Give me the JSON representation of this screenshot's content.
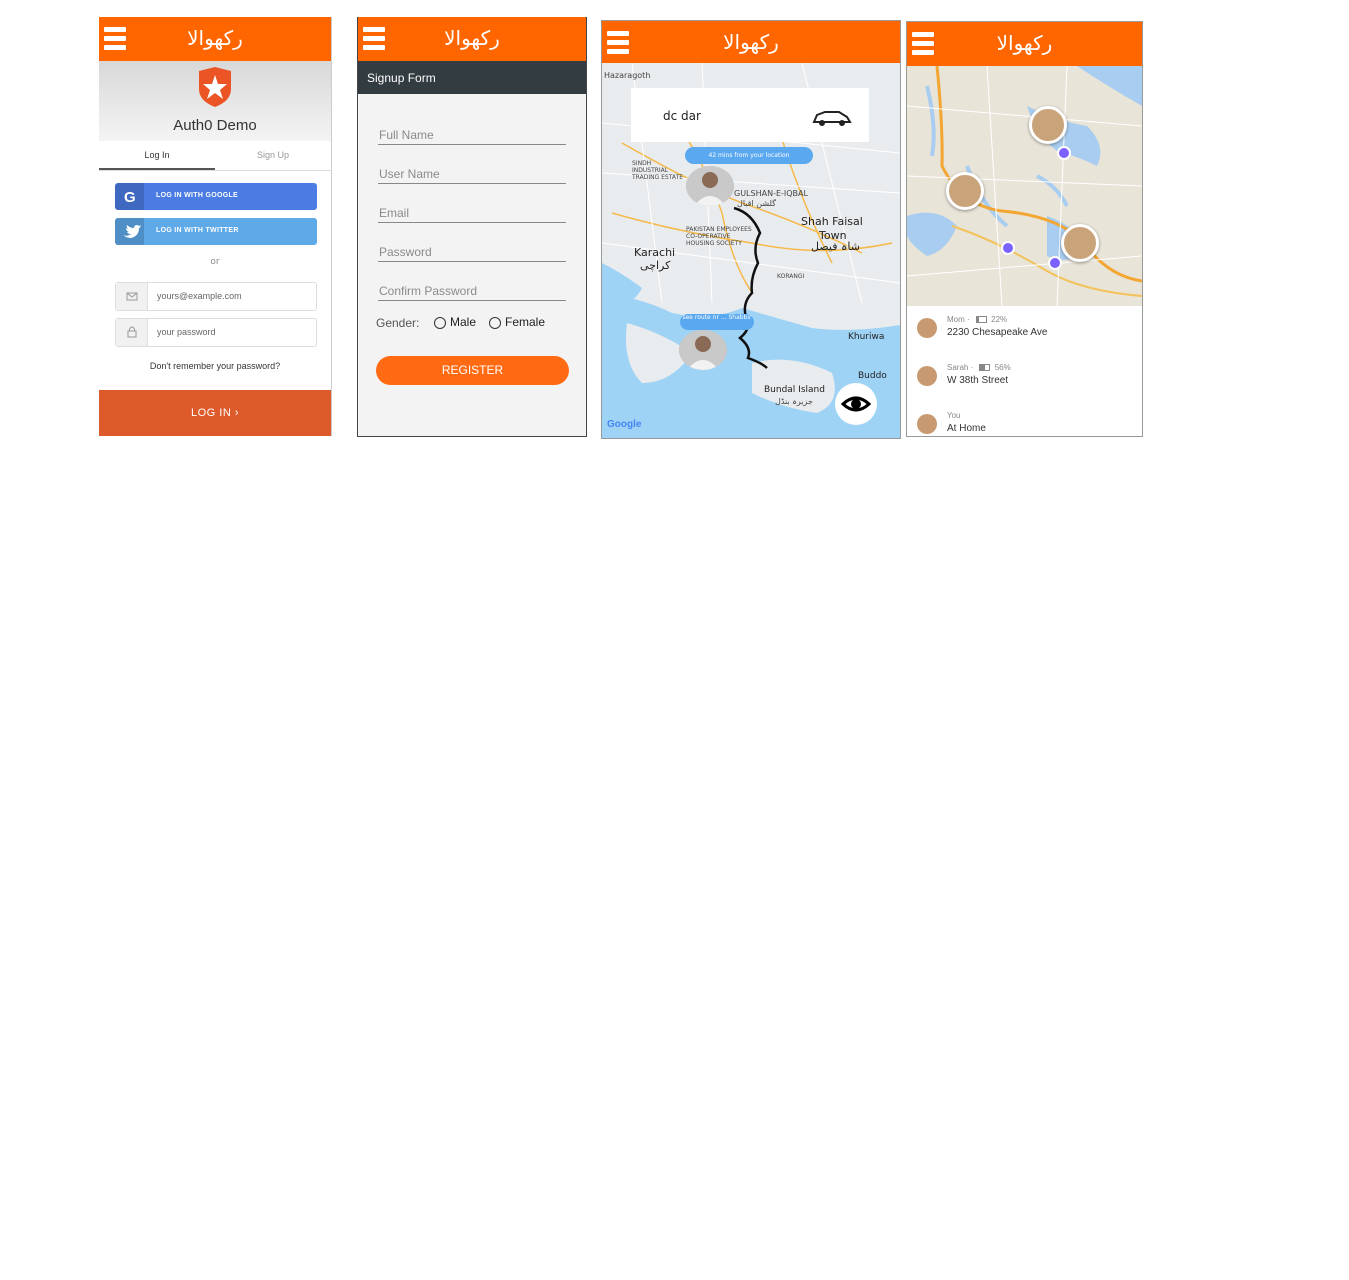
{
  "app": {
    "title": "رکھوالا"
  },
  "screen1": {
    "brand": "Auth0 Demo",
    "tabs": [
      "Log In",
      "Sign Up"
    ],
    "google_button": "LOG IN WITH GOOGLE",
    "twitter_button": "LOG IN WITH TWITTER",
    "or_text": "or",
    "email_placeholder": "yours@example.com",
    "password_placeholder": "your password",
    "forgot": "Don't remember your password?",
    "submit": "LOG IN ›",
    "colors": {
      "google": "#4a7ce3",
      "twitter": "#5ea9e8",
      "submit": "#dd5a2b"
    }
  },
  "screen2": {
    "header": "Signup Form",
    "fields": [
      "Full Name",
      "User Name",
      "Email",
      "Password",
      "Confirm Password"
    ],
    "gender_label": "Gender:",
    "gender_options": [
      "Male",
      "Female"
    ],
    "register": "REGISTER"
  },
  "screen3": {
    "search_text": "dc dar",
    "labels": {
      "karachi": "Karachi",
      "karachi_ur": "کراچی",
      "shah_faisal": "Shah Faisal",
      "town": "Town",
      "shah_faisal_ur": "شاہ فیصل",
      "gulshan": "GULSHAN-E-IQBAL",
      "gulshan_ur": "گلشن اقبال",
      "bundal": "Bundal Island",
      "bundal_ur": "جزیرہ بنڈل",
      "buddo": "Buddo",
      "khuri": "Khuriwa",
      "hazara": "Hazaragoth",
      "sindh": "SINDH INDUSTRIAL TRADING ESTATE",
      "pechs": "PAKISTAN EMPLOYEES CO-OPERATIVE HOUSING SOCIETY",
      "korangi": "KORANGI"
    },
    "bubble_top": "42 mins from your location",
    "bubble_bottom": "see route nr ... Shabbir",
    "google": "Google"
  },
  "screen4": {
    "members": [
      {
        "name": "Mom",
        "battery": "22%",
        "battery_level": 0.22,
        "address": "2230 Chesapeake Ave"
      },
      {
        "name": "Sarah",
        "battery": "56%",
        "battery_level": 0.56,
        "address": "W 38th Street"
      },
      {
        "name": "You",
        "battery": "",
        "battery_level": null,
        "address": "At Home"
      }
    ]
  }
}
